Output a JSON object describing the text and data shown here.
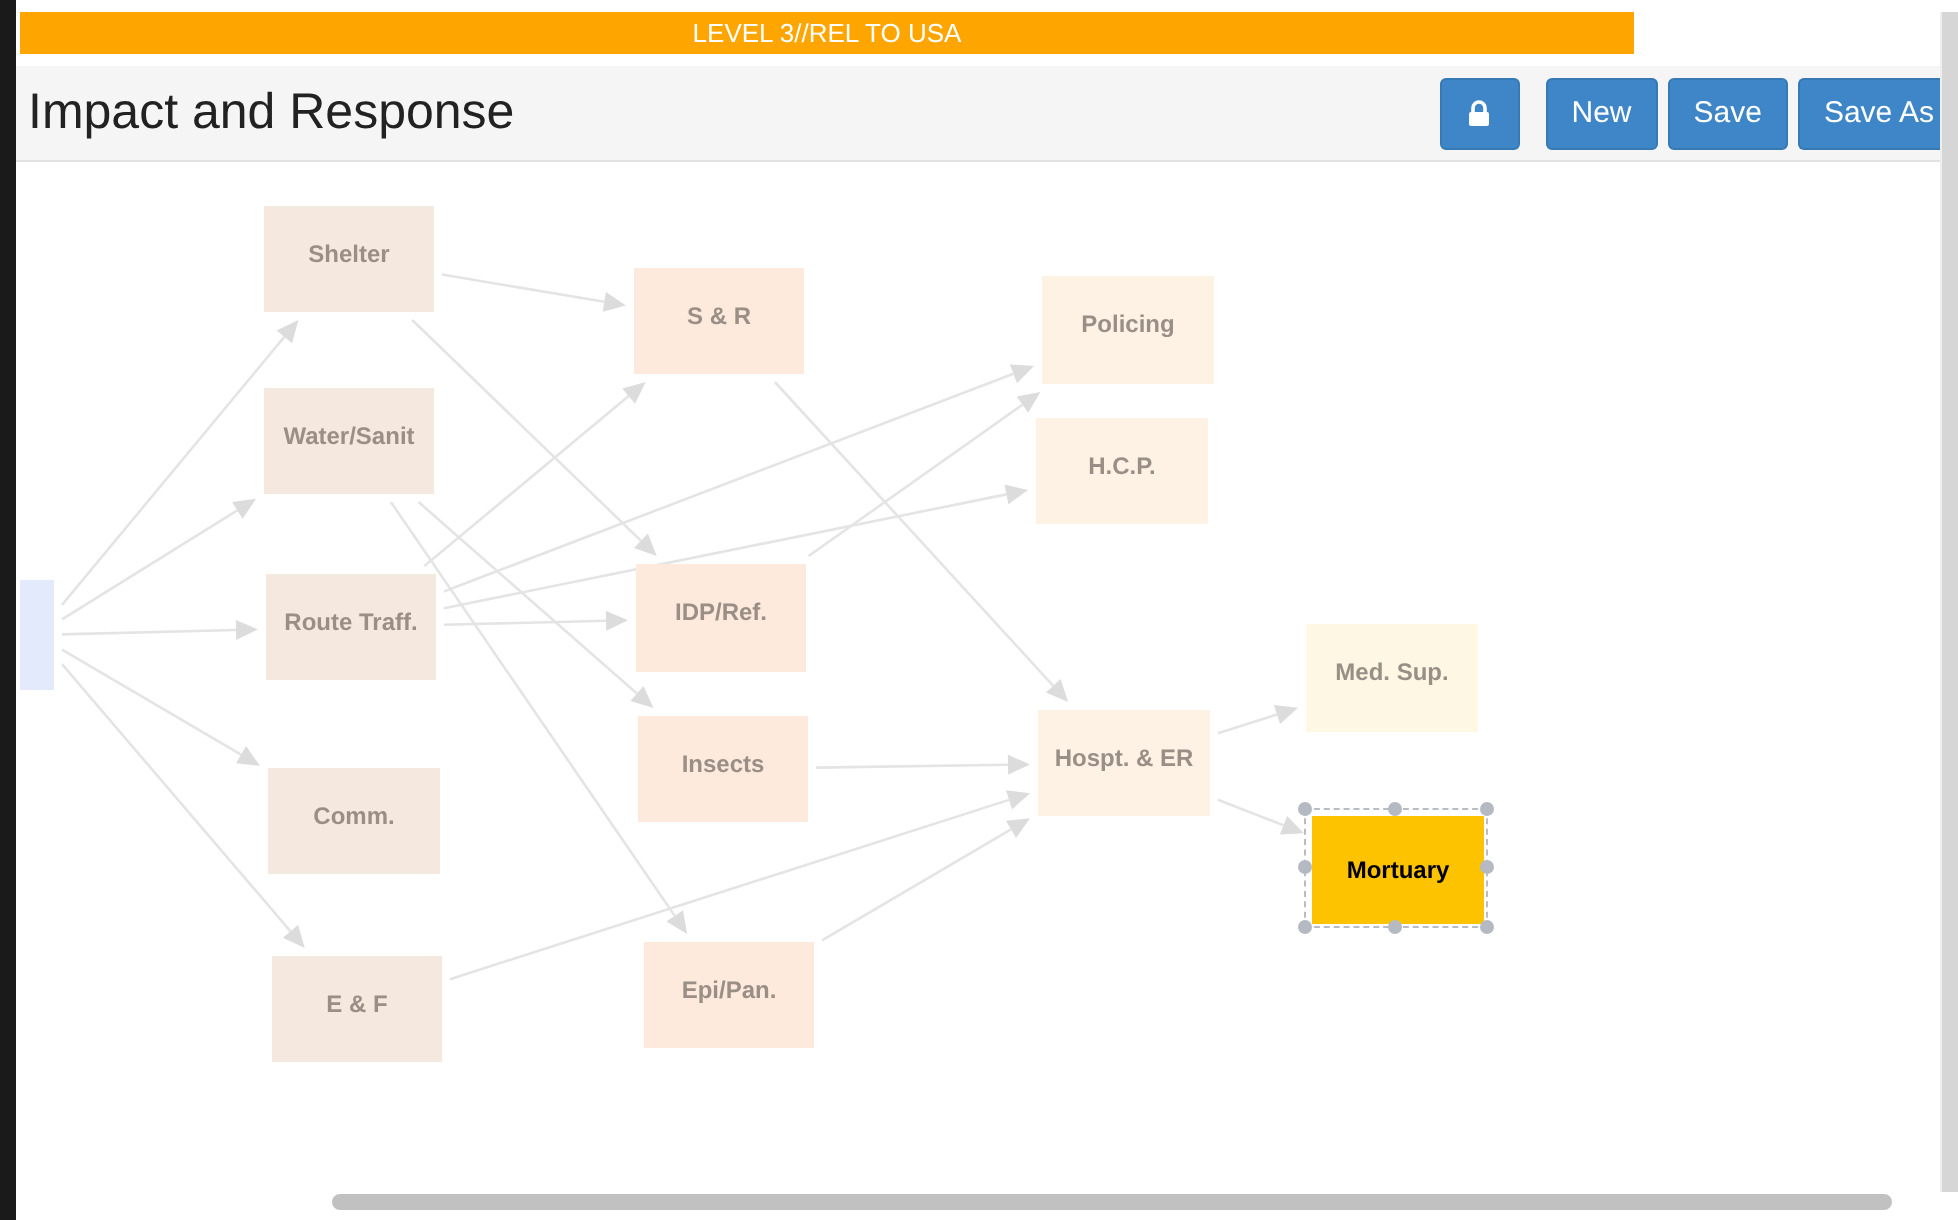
{
  "banner": {
    "text": "LEVEL 3//REL TO USA"
  },
  "header": {
    "title": "Impact and Response",
    "buttons": [
      {
        "kind": "lock"
      },
      {
        "kind": "text",
        "label": "New"
      },
      {
        "kind": "text",
        "label": "Save"
      },
      {
        "kind": "text",
        "label": "Save As"
      }
    ]
  },
  "diagram": {
    "nodes": [
      {
        "color": "#e3eafb",
        "selected": false
      },
      {
        "label": "Shelter",
        "color": "#f5e8de",
        "selected": false
      },
      {
        "label": "Water/Sanit",
        "color": "#f5e8de",
        "selected": false
      },
      {
        "label": "Route Traff.",
        "color": "#f5e8de",
        "selected": false
      },
      {
        "label": "Comm.",
        "color": "#f5e8de",
        "selected": false
      },
      {
        "label": "E & F",
        "color": "#f5e8de",
        "selected": false
      },
      {
        "label": "S & R",
        "color": "#fdeadc",
        "selected": false
      },
      {
        "label": "IDP/Ref.",
        "color": "#fdeadc",
        "selected": false
      },
      {
        "label": "Insects",
        "color": "#fdeadc",
        "selected": false
      },
      {
        "label": "Epi/Pan.",
        "color": "#fdeadc",
        "selected": false
      },
      {
        "label": "Policing",
        "color": "#fdf2e3",
        "selected": false
      },
      {
        "label": "H.C.P.",
        "color": "#fdf2e3",
        "selected": false
      },
      {
        "label": "Hospt. & ER",
        "color": "#fdf2e3",
        "selected": false
      },
      {
        "label": "Med. Sup.",
        "color": "#fdf7e3",
        "selected": false
      },
      {
        "label": "Mortuary",
        "color": "#fdc300",
        "selected": true
      }
    ]
  }
}
